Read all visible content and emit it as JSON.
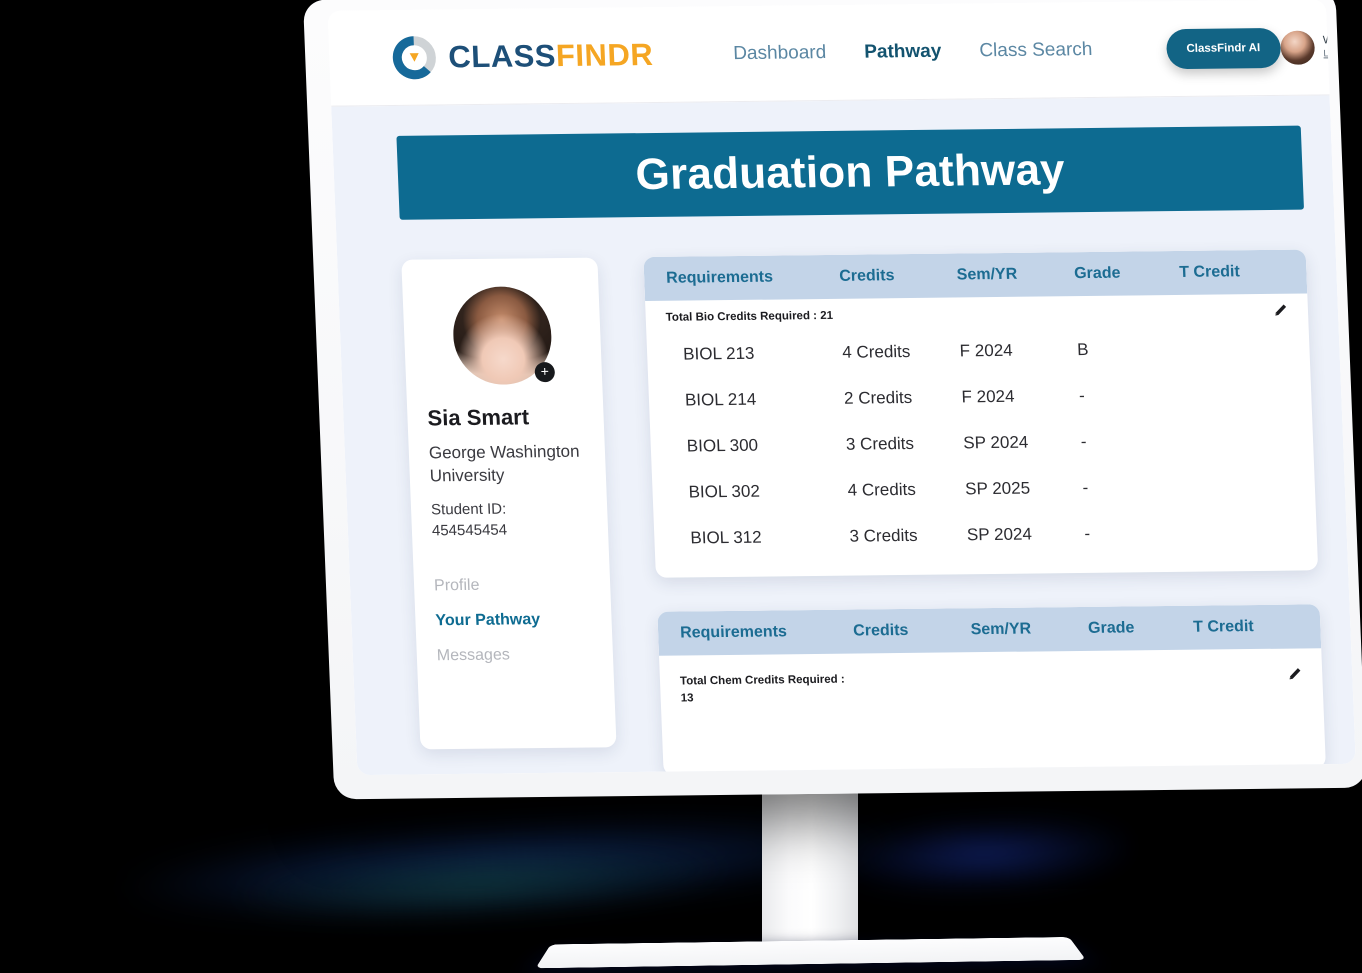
{
  "brand": {
    "logo_class": "CLASS",
    "logo_findr": "FINDR",
    "logo_mark": "classfindr-circle-pin-logo",
    "accent_teal": "#0d6b91",
    "accent_orange": "#f5a623",
    "table_header_bg": "#c3d4e8",
    "page_bg": "#eef2fa"
  },
  "topnav": {
    "links": [
      {
        "label": "Dashboard",
        "active": false
      },
      {
        "label": "Pathway",
        "active": true
      },
      {
        "label": "Class Search",
        "active": false
      }
    ],
    "ai_button": "ClassFindr AI",
    "user": {
      "avatar": "user-avatar",
      "greeting": "Welcome Back Sia",
      "logout": "Logout"
    }
  },
  "banner": {
    "title": "Graduation Pathway"
  },
  "profile": {
    "avatar": "student-avatar",
    "add_photo_icon": "plus-icon",
    "name": "Sia Smart",
    "school": "George Washington University",
    "student_id_label": "Student ID:",
    "student_id": "454545454",
    "nav": [
      {
        "label": "Profile",
        "active": false
      },
      {
        "label": "Your Pathway",
        "active": true
      },
      {
        "label": "Messages",
        "active": false
      }
    ]
  },
  "tables": [
    {
      "columns": [
        "Requirements",
        "Credits",
        "Sem/YR",
        "Grade",
        "T Credit"
      ],
      "subtitle": "Total Bio Credits Required : 21",
      "edit_icon": "pencil-icon",
      "rows": [
        {
          "requirement": "BIOL 213",
          "credits": "4 Credits",
          "sem_yr": "F 2024",
          "grade": "B",
          "t_credit": ""
        },
        {
          "requirement": "BIOL 214",
          "credits": "2 Credits",
          "sem_yr": "F 2024",
          "grade": "-",
          "t_credit": ""
        },
        {
          "requirement": "BIOL 300",
          "credits": "3 Credits",
          "sem_yr": "SP 2024",
          "grade": "-",
          "t_credit": ""
        },
        {
          "requirement": "BIOL 302",
          "credits": "4 Credits",
          "sem_yr": "SP 2025",
          "grade": "-",
          "t_credit": ""
        },
        {
          "requirement": "BIOL 312",
          "credits": "3 Credits",
          "sem_yr": "SP 2024",
          "grade": "-",
          "t_credit": ""
        }
      ]
    },
    {
      "columns": [
        "Requirements",
        "Credits",
        "Sem/YR",
        "Grade",
        "T Credit"
      ],
      "subtitle": "Total Chem Credits Required : 13",
      "edit_icon": "pencil-icon",
      "rows": []
    }
  ]
}
